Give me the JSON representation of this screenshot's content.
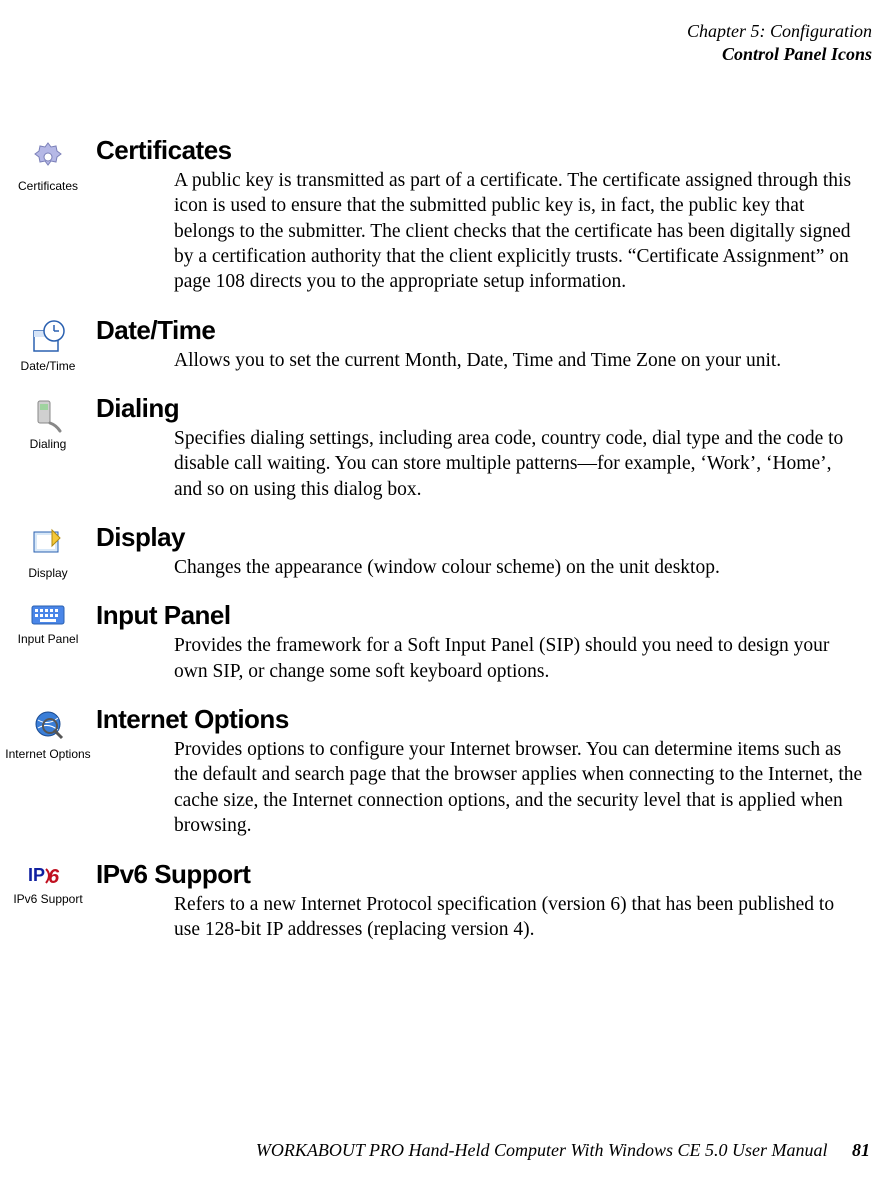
{
  "header": {
    "chapter": "Chapter 5: Configuration",
    "section": "Control Panel Icons"
  },
  "sections": [
    {
      "icon_label": "Certificates",
      "title": "Certificates",
      "body": "A public key is transmitted as part of a certificate. The certificate assigned through this icon is used to ensure that the submitted public key is, in fact, the public key that belongs to the submitter. The client checks that the certificate has been digitally signed by a certification authority that the client explicitly trusts. “Certificate Assignment” on page 108 directs you to the appropriate setup information."
    },
    {
      "icon_label": "Date/Time",
      "title": "Date/Time",
      "body": "Allows you to set the current Month, Date, Time and Time Zone on your unit."
    },
    {
      "icon_label": "Dialing",
      "title": "Dialing",
      "body": "Specifies dialing settings, including area code, country code, dial type and the code to disable call waiting. You can store multiple patterns—for example, ‘Work’, ‘Home’, and so on using this dialog box."
    },
    {
      "icon_label": "Display",
      "title": "Display",
      "body": "Changes the appearance (window colour scheme) on the unit desktop."
    },
    {
      "icon_label": "Input Panel",
      "title": "Input Panel",
      "body": "Provides the framework for a Soft Input Panel (SIP) should you need to design your own SIP, or change some soft keyboard options."
    },
    {
      "icon_label": "Internet Options",
      "title": "Internet Options",
      "body": "Provides options to configure your Internet browser. You can determine items such as the default and search page that the browser applies when connecting to the Internet, the cache size, the Internet connection options, and the security level that is applied when browsing."
    },
    {
      "icon_label": "IPv6 Support",
      "title": "IPv6 Support",
      "body": "Refers to a new Internet Protocol specification (version 6) that has been published to use 128-bit IP addresses (replacing version 4)."
    }
  ],
  "footer": {
    "text": "WORKABOUT PRO Hand-Held Computer With Windows CE 5.0 User Manual",
    "page": "81"
  }
}
